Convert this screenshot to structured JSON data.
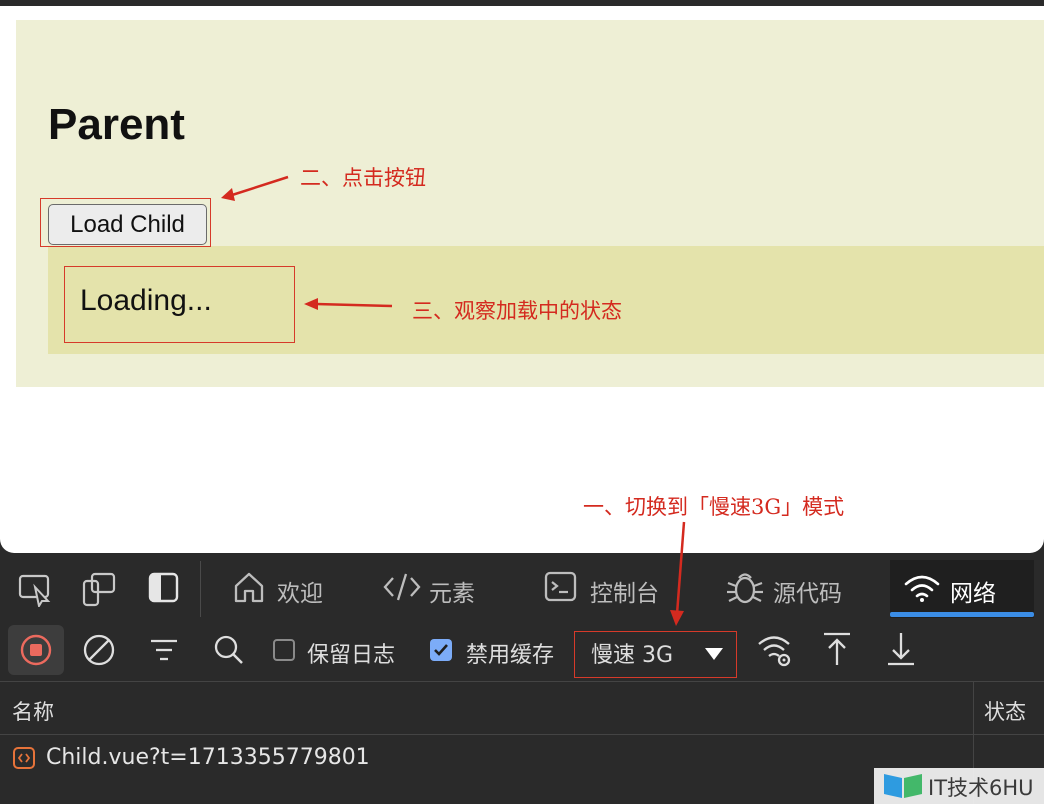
{
  "page": {
    "heading": "Parent",
    "button_label": "Load Child",
    "loading_text": "Loading..."
  },
  "annotations": {
    "click_button": "二、点击按钮",
    "observe_state": "三、观察加载中的状态",
    "switch_mode": "一、切换到「慢速3G」模式"
  },
  "devtools": {
    "tabs": [
      {
        "label": "欢迎",
        "icon": "home-icon"
      },
      {
        "label": "元素",
        "icon": "code-icon"
      },
      {
        "label": "控制台",
        "icon": "terminal-icon"
      },
      {
        "label": "源代码",
        "icon": "bug-icon"
      },
      {
        "label": "网络",
        "icon": "wifi-icon",
        "active": true
      }
    ],
    "toolbar": {
      "preserve_log": "保留日志",
      "preserve_log_checked": false,
      "disable_cache": "禁用缓存",
      "disable_cache_checked": true,
      "throttling": "慢速 3G"
    },
    "table": {
      "col_name": "名称",
      "col_status": "状态",
      "rows": [
        {
          "name": "Child.vue?t=1713355779801",
          "icon": "vue-file-icon"
        }
      ]
    },
    "accent_color": "#3b8de6"
  },
  "watermark": "IT技术6HU",
  "colors": {
    "parent_bg": "#eeefd5",
    "child_bg": "#e4e3ab",
    "annotation_red": "#d42a1f",
    "devtools_bg": "#2a2a2a"
  }
}
